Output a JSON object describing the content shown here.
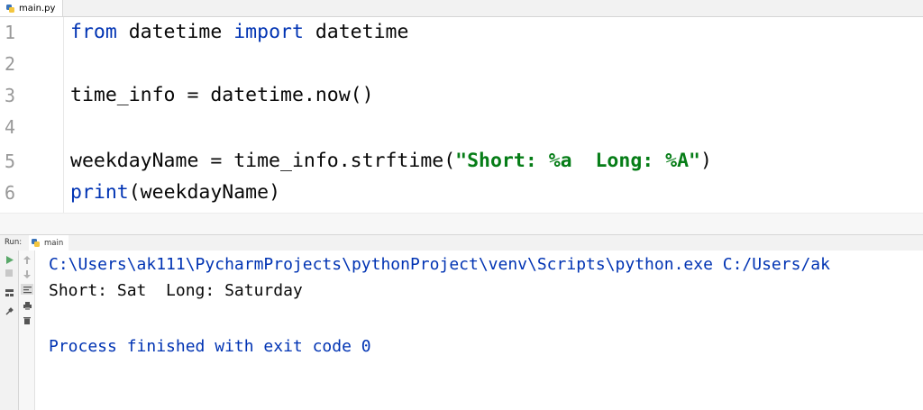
{
  "editor": {
    "tab": {
      "filename": "main.py"
    },
    "lines": [
      {
        "number": "1",
        "parts": [
          {
            "text": "from",
            "kind": "kw"
          },
          {
            "text": " datetime ",
            "kind": "plain"
          },
          {
            "text": "import",
            "kind": "kw"
          },
          {
            "text": " datetime",
            "kind": "plain"
          }
        ]
      },
      {
        "number": "2",
        "parts": []
      },
      {
        "number": "3",
        "parts": [
          {
            "text": "time_info = datetime.now()",
            "kind": "plain"
          }
        ]
      },
      {
        "number": "4",
        "parts": []
      },
      {
        "number": "5",
        "parts": [
          {
            "text": "weekdayName = time_info.strftime(",
            "kind": "plain"
          },
          {
            "text": "\"Short: %a  Long: %A\"",
            "kind": "str"
          },
          {
            "text": ")",
            "kind": "plain"
          }
        ]
      },
      {
        "number": "6",
        "parts": [
          {
            "text": "print",
            "kind": "kw"
          },
          {
            "text": "(weekdayName)",
            "kind": "plain"
          }
        ]
      }
    ]
  },
  "run_panel": {
    "label": "Run:",
    "tab_label": "main",
    "output": {
      "command": "C:\\Users\\ak111\\PycharmProjects\\pythonProject\\venv\\Scripts\\python.exe C:/Users/ak",
      "result": "Short: Sat  Long: Saturday",
      "exit_message": "Process finished with exit code 0"
    }
  },
  "colors": {
    "keyword": "#0033b3",
    "string": "#067d17",
    "run_green": "#59a869"
  }
}
